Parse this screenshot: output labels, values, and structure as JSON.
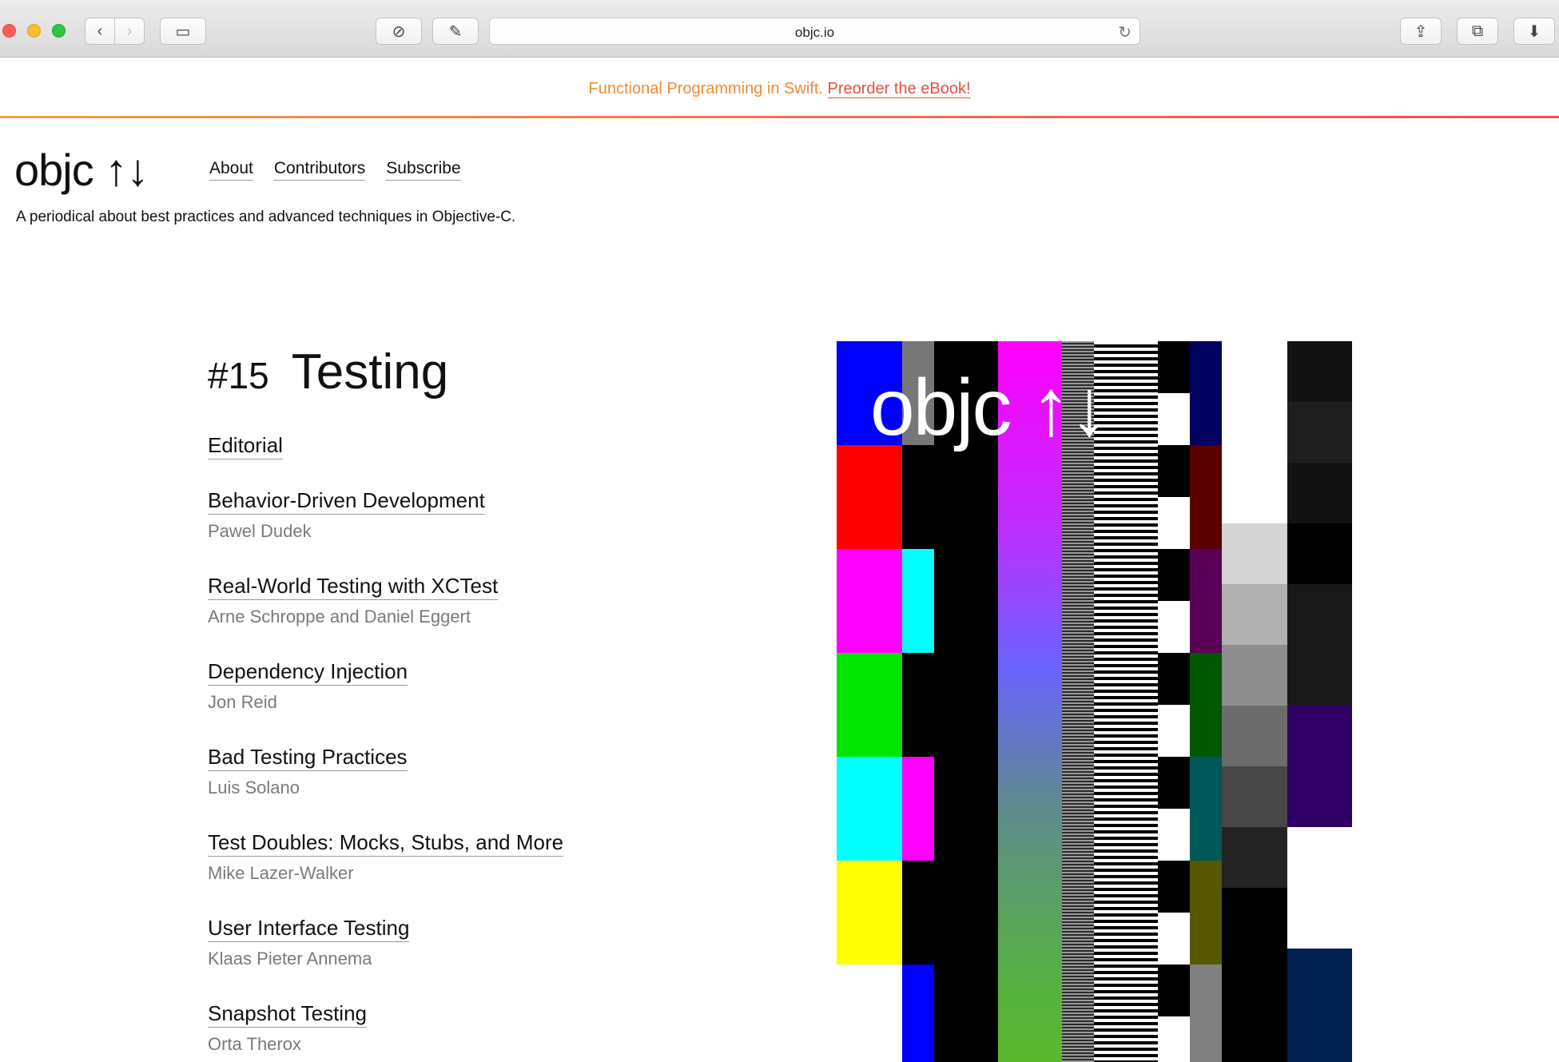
{
  "browser": {
    "url": "objc.io",
    "back_icon": "‹",
    "forward_icon": "›",
    "sidebar_icon": "▭",
    "history_icon": "⊘",
    "tools_icon": "✎",
    "reload_icon": "↻",
    "share_icon": "⇪",
    "tabs_icon": "⧉",
    "download_icon": "⬇"
  },
  "banner": {
    "text": "Functional Programming in Swift.",
    "link": "Preorder the eBook!"
  },
  "site": {
    "logo": "objc ↑↓",
    "nav": [
      "About",
      "Contributors",
      "Subscribe"
    ],
    "tagline": "A periodical about best practices and advanced techniques in Objective-C."
  },
  "issue": {
    "number": "#15",
    "title": "Testing",
    "articles": [
      {
        "title": "Editorial",
        "author": ""
      },
      {
        "title": "Behavior-Driven Development",
        "author": "Pawel Dudek"
      },
      {
        "title": "Real-World Testing with XCTest",
        "author": "Arne Schroppe and Daniel Eggert"
      },
      {
        "title": "Dependency Injection",
        "author": "Jon Reid"
      },
      {
        "title": "Bad Testing Practices",
        "author": "Luis Solano"
      },
      {
        "title": "Test Doubles: Mocks, Stubs, and More",
        "author": "Mike Lazer-Walker"
      },
      {
        "title": "User Interface Testing",
        "author": "Klaas Pieter Annema"
      },
      {
        "title": "Snapshot Testing",
        "author": "Orta Therox"
      }
    ]
  },
  "cover": {
    "logo": "objc ↑↓"
  }
}
